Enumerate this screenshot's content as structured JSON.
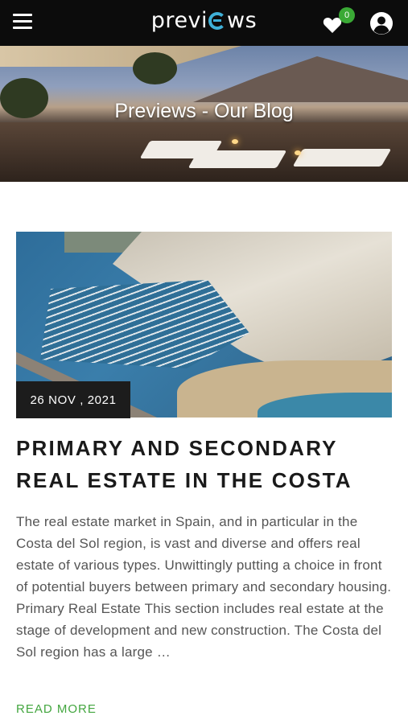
{
  "header": {
    "logo_text_left": "previ",
    "logo_text_right": "ws",
    "wishlist_count": "0",
    "colors": {
      "background": "#0c0c0c",
      "badge": "#3aa935",
      "logo_accent": "#3fb0d8"
    },
    "icons": [
      "hamburger-menu-icon",
      "heart-icon",
      "user-account-icon"
    ]
  },
  "hero": {
    "title": "Previews - Our Blog"
  },
  "article": {
    "date": "26 NOV , 2021",
    "title_line1": "PRIMARY AND SECONDARY",
    "title_line2": "REAL ESTATE IN THE COSTA",
    "excerpt": "The real estate market in Spain, and in particular in the Costa del Sol region, is vast and diverse and offers real estate of various types. Unwittingly putting a choice in front of potential buyers between primary and secondary housing. Primary Real Estate This section includes real estate at the stage of development and new construction. The Costa del Sol region has a large …",
    "read_more": "READ MORE",
    "read_more_color": "#43a63f"
  }
}
